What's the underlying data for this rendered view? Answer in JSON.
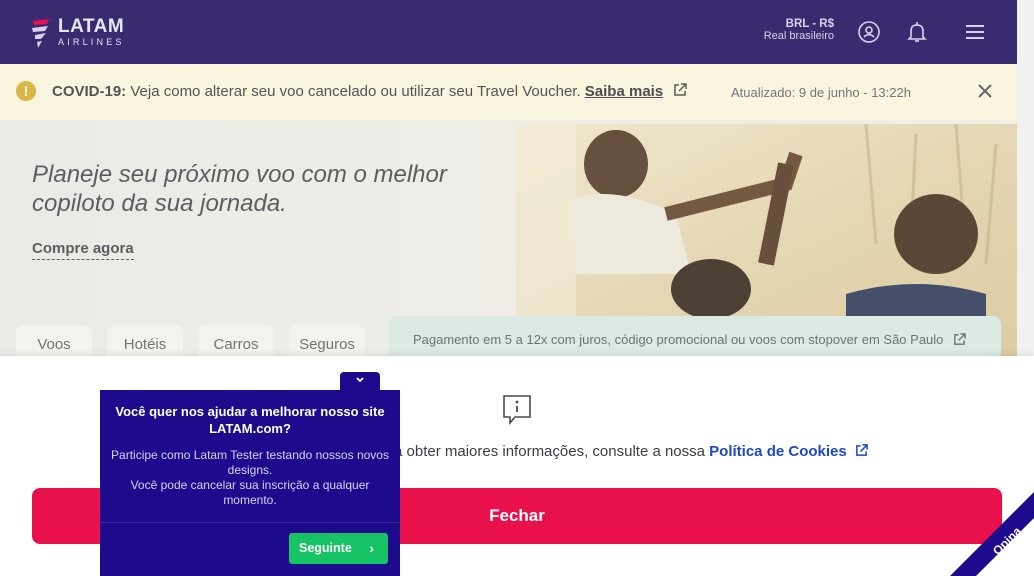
{
  "header": {
    "logo_main": "LATAM",
    "logo_sub": "AIRLINES",
    "currency_code": "BRL - R$",
    "currency_name": "Real brasileiro",
    "icons": [
      "account-icon",
      "bell-icon",
      "menu-icon"
    ],
    "bg_color": "#3a2a70"
  },
  "covid_banner": {
    "label": "COVID-19:",
    "message": "Veja como alterar seu voo cancelado ou utilizar seu Travel Voucher.",
    "link": "Saiba mais",
    "updated": "Atualizado: 9 de junho - 13:22h"
  },
  "hero": {
    "title": "Planeje seu próximo voo com o melhor copiloto da sua jornada.",
    "cta": "Compre agora",
    "tabs": [
      "Voos",
      "Hotéis",
      "Carros",
      "Seguros"
    ],
    "promo": "Pagamento em 5 a 12x com juros, código promocional ou voos com stopover em São Paulo"
  },
  "cookie_panel": {
    "text_prefix": "a obter maiores informações, consulte a nossa",
    "link": "Política de Cookies",
    "close_button": "Fechar",
    "button_color": "#e8114b"
  },
  "survey": {
    "toggle": "⌄",
    "title": "Você quer nos ajudar a melhorar nosso site LATAM.com?",
    "body_1": "Participe como Latam Tester testando nossos novos designs.",
    "body_2": "Você pode cancelar sua inscrição a qualquer momento.",
    "button": "Seguinte",
    "bg_color": "#1e0a8c",
    "button_color": "#16c465"
  },
  "opina": {
    "label": "Opina"
  }
}
